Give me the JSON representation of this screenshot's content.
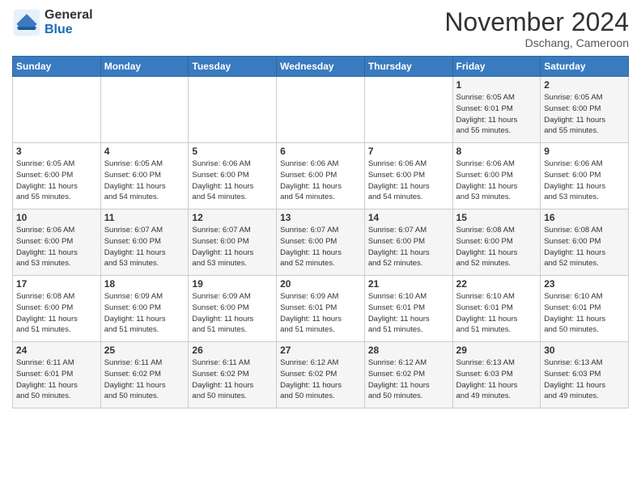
{
  "header": {
    "logo_general": "General",
    "logo_blue": "Blue",
    "month": "November 2024",
    "location": "Dschang, Cameroon"
  },
  "weekdays": [
    "Sunday",
    "Monday",
    "Tuesday",
    "Wednesday",
    "Thursday",
    "Friday",
    "Saturday"
  ],
  "weeks": [
    [
      {
        "day": "",
        "info": ""
      },
      {
        "day": "",
        "info": ""
      },
      {
        "day": "",
        "info": ""
      },
      {
        "day": "",
        "info": ""
      },
      {
        "day": "",
        "info": ""
      },
      {
        "day": "1",
        "info": "Sunrise: 6:05 AM\nSunset: 6:01 PM\nDaylight: 11 hours\nand 55 minutes."
      },
      {
        "day": "2",
        "info": "Sunrise: 6:05 AM\nSunset: 6:00 PM\nDaylight: 11 hours\nand 55 minutes."
      }
    ],
    [
      {
        "day": "3",
        "info": "Sunrise: 6:05 AM\nSunset: 6:00 PM\nDaylight: 11 hours\nand 55 minutes."
      },
      {
        "day": "4",
        "info": "Sunrise: 6:05 AM\nSunset: 6:00 PM\nDaylight: 11 hours\nand 54 minutes."
      },
      {
        "day": "5",
        "info": "Sunrise: 6:06 AM\nSunset: 6:00 PM\nDaylight: 11 hours\nand 54 minutes."
      },
      {
        "day": "6",
        "info": "Sunrise: 6:06 AM\nSunset: 6:00 PM\nDaylight: 11 hours\nand 54 minutes."
      },
      {
        "day": "7",
        "info": "Sunrise: 6:06 AM\nSunset: 6:00 PM\nDaylight: 11 hours\nand 54 minutes."
      },
      {
        "day": "8",
        "info": "Sunrise: 6:06 AM\nSunset: 6:00 PM\nDaylight: 11 hours\nand 53 minutes."
      },
      {
        "day": "9",
        "info": "Sunrise: 6:06 AM\nSunset: 6:00 PM\nDaylight: 11 hours\nand 53 minutes."
      }
    ],
    [
      {
        "day": "10",
        "info": "Sunrise: 6:06 AM\nSunset: 6:00 PM\nDaylight: 11 hours\nand 53 minutes."
      },
      {
        "day": "11",
        "info": "Sunrise: 6:07 AM\nSunset: 6:00 PM\nDaylight: 11 hours\nand 53 minutes."
      },
      {
        "day": "12",
        "info": "Sunrise: 6:07 AM\nSunset: 6:00 PM\nDaylight: 11 hours\nand 53 minutes."
      },
      {
        "day": "13",
        "info": "Sunrise: 6:07 AM\nSunset: 6:00 PM\nDaylight: 11 hours\nand 52 minutes."
      },
      {
        "day": "14",
        "info": "Sunrise: 6:07 AM\nSunset: 6:00 PM\nDaylight: 11 hours\nand 52 minutes."
      },
      {
        "day": "15",
        "info": "Sunrise: 6:08 AM\nSunset: 6:00 PM\nDaylight: 11 hours\nand 52 minutes."
      },
      {
        "day": "16",
        "info": "Sunrise: 6:08 AM\nSunset: 6:00 PM\nDaylight: 11 hours\nand 52 minutes."
      }
    ],
    [
      {
        "day": "17",
        "info": "Sunrise: 6:08 AM\nSunset: 6:00 PM\nDaylight: 11 hours\nand 51 minutes."
      },
      {
        "day": "18",
        "info": "Sunrise: 6:09 AM\nSunset: 6:00 PM\nDaylight: 11 hours\nand 51 minutes."
      },
      {
        "day": "19",
        "info": "Sunrise: 6:09 AM\nSunset: 6:00 PM\nDaylight: 11 hours\nand 51 minutes."
      },
      {
        "day": "20",
        "info": "Sunrise: 6:09 AM\nSunset: 6:01 PM\nDaylight: 11 hours\nand 51 minutes."
      },
      {
        "day": "21",
        "info": "Sunrise: 6:10 AM\nSunset: 6:01 PM\nDaylight: 11 hours\nand 51 minutes."
      },
      {
        "day": "22",
        "info": "Sunrise: 6:10 AM\nSunset: 6:01 PM\nDaylight: 11 hours\nand 51 minutes."
      },
      {
        "day": "23",
        "info": "Sunrise: 6:10 AM\nSunset: 6:01 PM\nDaylight: 11 hours\nand 50 minutes."
      }
    ],
    [
      {
        "day": "24",
        "info": "Sunrise: 6:11 AM\nSunset: 6:01 PM\nDaylight: 11 hours\nand 50 minutes."
      },
      {
        "day": "25",
        "info": "Sunrise: 6:11 AM\nSunset: 6:02 PM\nDaylight: 11 hours\nand 50 minutes."
      },
      {
        "day": "26",
        "info": "Sunrise: 6:11 AM\nSunset: 6:02 PM\nDaylight: 11 hours\nand 50 minutes."
      },
      {
        "day": "27",
        "info": "Sunrise: 6:12 AM\nSunset: 6:02 PM\nDaylight: 11 hours\nand 50 minutes."
      },
      {
        "day": "28",
        "info": "Sunrise: 6:12 AM\nSunset: 6:02 PM\nDaylight: 11 hours\nand 50 minutes."
      },
      {
        "day": "29",
        "info": "Sunrise: 6:13 AM\nSunset: 6:03 PM\nDaylight: 11 hours\nand 49 minutes."
      },
      {
        "day": "30",
        "info": "Sunrise: 6:13 AM\nSunset: 6:03 PM\nDaylight: 11 hours\nand 49 minutes."
      }
    ]
  ]
}
